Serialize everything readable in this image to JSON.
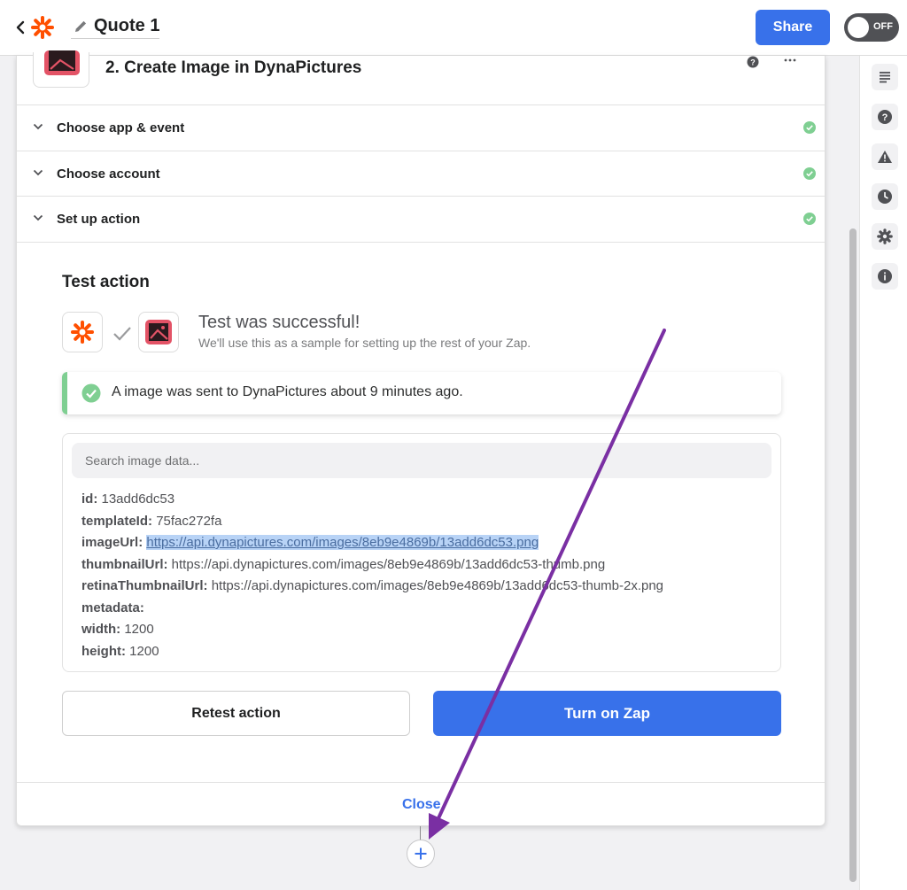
{
  "header": {
    "zap_title": "Quote 1",
    "share_label": "Share",
    "toggle_label": "OFF"
  },
  "step": {
    "title": "2. Create Image in DynaPictures"
  },
  "sections": [
    {
      "label": "Choose app & event"
    },
    {
      "label": "Choose account"
    },
    {
      "label": "Set up action"
    }
  ],
  "test": {
    "title": "Test action",
    "success_title": "Test was successful!",
    "success_sub": "We'll use this as a sample for setting up the rest of your Zap.",
    "alert_text": "A image was sent to DynaPictures about 9 minutes ago.",
    "search_placeholder": "Search image data...",
    "fields": [
      {
        "key": "id:",
        "value": "13add6dc53"
      },
      {
        "key": "templateId:",
        "value": "75fac272fa"
      },
      {
        "key": "imageUrl:",
        "value": "https://api.dynapictures.com/images/8eb9e4869b/13add6dc53.png"
      },
      {
        "key": "thumbnailUrl:",
        "value": "https://api.dynapictures.com/images/8eb9e4869b/13add6dc53-thumb.png"
      },
      {
        "key": "retinaThumbnailUrl:",
        "value": "https://api.dynapictures.com/images/8eb9e4869b/13add6dc53-thumb-2x.png"
      },
      {
        "key": "metadata:",
        "value": ""
      },
      {
        "key": "width:",
        "value": "1200"
      },
      {
        "key": "height:",
        "value": "1200"
      }
    ],
    "retest_label": "Retest action",
    "turn_on_label": "Turn on Zap"
  },
  "footer": {
    "close_label": "Close"
  },
  "colors": {
    "accent": "#3871ea",
    "zapier_orange": "#ff4f00",
    "dynapictures_red": "#e35366",
    "success_green": "#7fcf92",
    "annotation_arrow": "#7a2fa3"
  },
  "icons": [
    "back-icon",
    "zapier-logo-icon",
    "pencil-icon",
    "notes-icon",
    "help-icon",
    "warning-icon",
    "clock-icon",
    "gear-icon",
    "info-icon",
    "chevron-down-icon",
    "check-circle-icon",
    "checkmark-icon",
    "plus-icon",
    "more-icon",
    "dynapictures-image-icon"
  ]
}
